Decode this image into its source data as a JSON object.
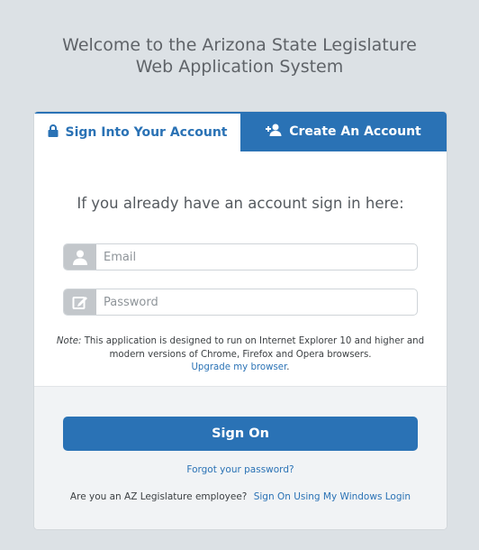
{
  "header": {
    "title_line1": "Welcome to the Arizona State Legislature",
    "title_line2": "Web Application System"
  },
  "tabs": {
    "signin_label": "Sign Into Your Account",
    "create_label": "Create An Account"
  },
  "form": {
    "heading": "If you already have an account sign in here:",
    "email_placeholder": "Email",
    "email_value": "",
    "password_placeholder": "Password",
    "password_value": ""
  },
  "note": {
    "label": "Note:",
    "text": " This application is designed to run on Internet Explorer 10 and higher and modern versions of Chrome, Firefox and Opera browsers.",
    "link": "Upgrade my browser",
    "suffix": "."
  },
  "footer": {
    "signon_label": "Sign On",
    "forgot_label": "Forgot your password?",
    "employee_text": "Are you an AZ Legislature employee?",
    "windows_login_label": "Sign On Using My Windows Login"
  },
  "colors": {
    "accent": "#2a72b5",
    "background": "#dce1e5",
    "footer_bg": "#f1f3f5"
  },
  "icons": {
    "signin_tab": "lock-icon",
    "create_tab": "add-user-icon",
    "email": "user-icon",
    "password": "edit-icon"
  }
}
